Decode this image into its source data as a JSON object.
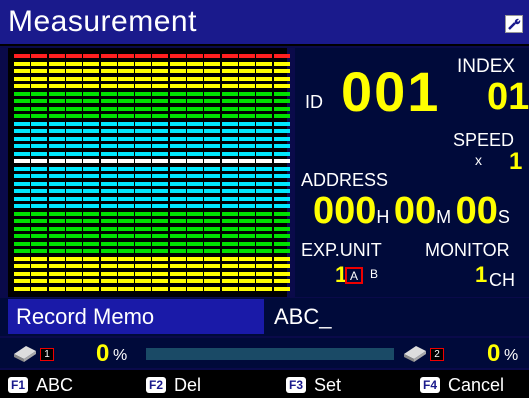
{
  "app": {
    "title": "Measurement"
  },
  "colors": {
    "title_bg": "#1a1a8c",
    "panel_bg": "#000a3a",
    "value_yellow": "#ffff00",
    "meter_red": "#ff2020",
    "meter_yellow": "#ffff00",
    "meter_green": "#00e000",
    "meter_cyan": "#00e8ff",
    "meter_white": "#ffffff"
  },
  "meter": {
    "channel_count": 16,
    "segment_count": 32
  },
  "info": {
    "id_label": "ID",
    "id_value": "001",
    "index_label": "INDEX",
    "index_value": "01",
    "speed_label": "SPEED",
    "speed_prefix": "x",
    "speed_value": "1",
    "address_label": "ADDRESS",
    "address_hours": "000",
    "address_h_unit": "H",
    "address_minutes": "00",
    "address_m_unit": "M",
    "address_seconds": "00",
    "address_s_unit": "S",
    "exp_unit_label": "EXP.UNIT",
    "exp_unit_value": "1",
    "exp_a": "A",
    "exp_b": "B",
    "monitor_label": "MONITOR",
    "monitor_value": "1",
    "monitor_unit": "CH"
  },
  "memo": {
    "label": "Record Memo",
    "value": "ABC_"
  },
  "status": {
    "disk1_num": "1",
    "disk1_percent": "0",
    "percent_symbol": "%",
    "progress_fraction": 0.0,
    "disk2_num": "2",
    "disk2_percent": "0"
  },
  "function_keys": [
    {
      "tag": "F1",
      "label": "ABC"
    },
    {
      "tag": "F2",
      "label": "Del"
    },
    {
      "tag": "F3",
      "label": "Set"
    },
    {
      "tag": "F4",
      "label": "Cancel"
    }
  ]
}
